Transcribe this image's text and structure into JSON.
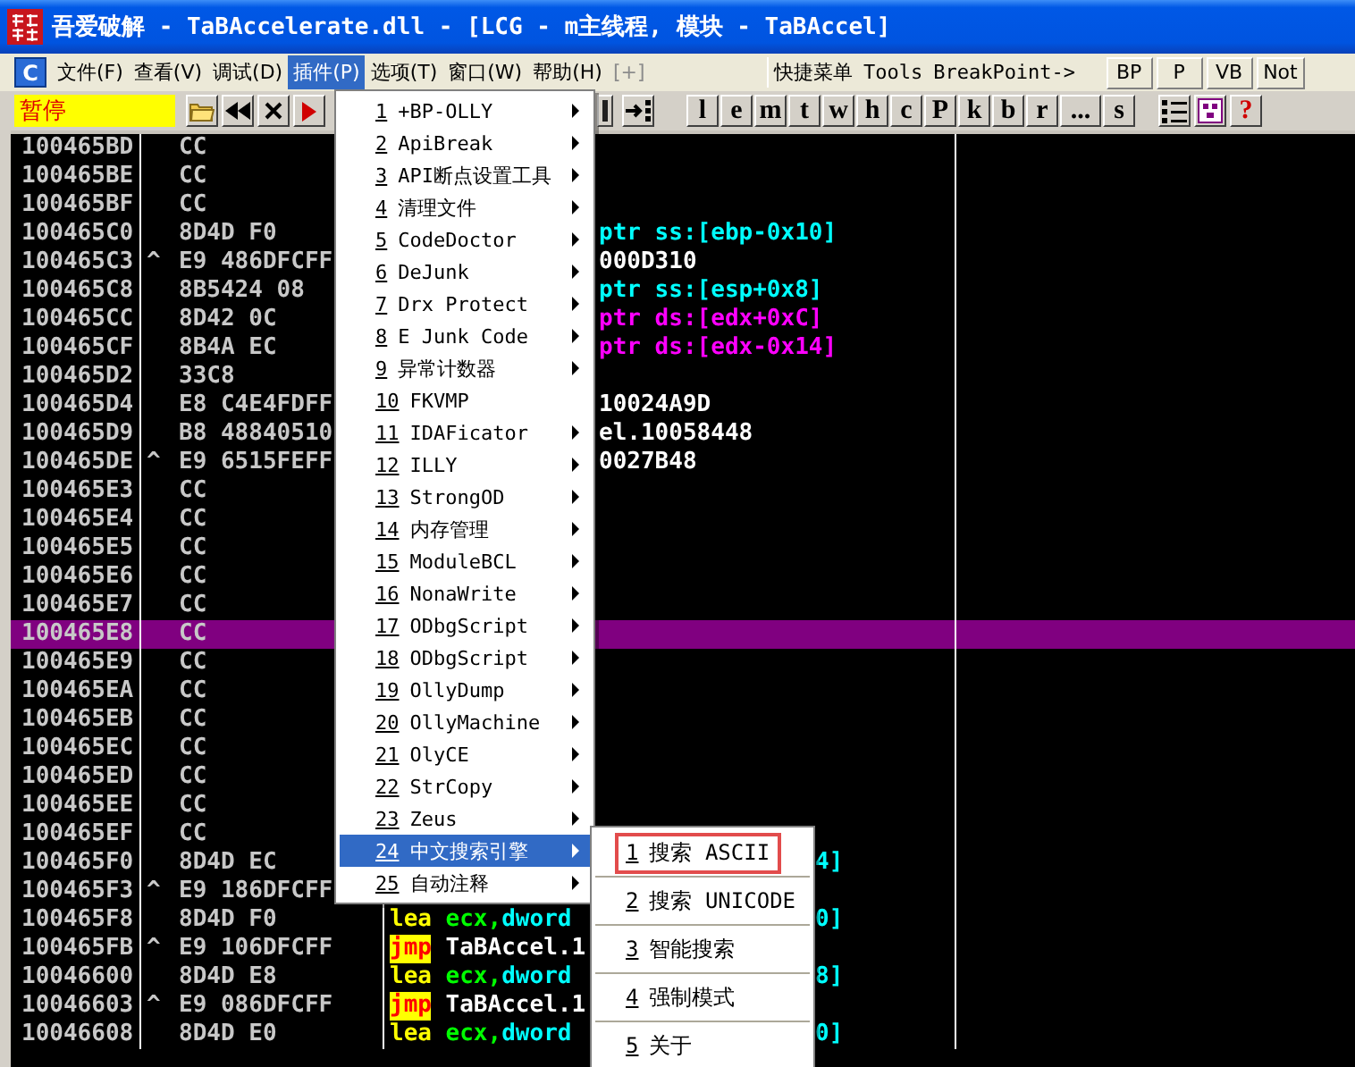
{
  "window": {
    "title": "吾爱破解 - TaBAccelerate.dll - [LCG - m主线程, 模块 - TaBAccel]"
  },
  "menubar": {
    "app_button": "C",
    "menus": [
      {
        "label": "文件(F)",
        "selected": false,
        "disabled": false
      },
      {
        "label": "查看(V)",
        "selected": false,
        "disabled": false
      },
      {
        "label": "调试(D)",
        "selected": false,
        "disabled": false
      },
      {
        "label": "插件(P)",
        "selected": true,
        "disabled": false
      },
      {
        "label": "选项(T)",
        "selected": false,
        "disabled": false
      },
      {
        "label": "窗口(W)",
        "selected": false,
        "disabled": false
      },
      {
        "label": "帮助(H)",
        "selected": false,
        "disabled": false
      },
      {
        "label": "[+]",
        "selected": false,
        "disabled": true
      },
      {
        "label": "快捷菜单",
        "selected": false,
        "disabled": false
      },
      {
        "label": "Tools",
        "selected": false,
        "disabled": false
      },
      {
        "label": "BreakPoint->",
        "selected": false,
        "disabled": false
      }
    ],
    "buttons": [
      "BP",
      "P",
      "VB",
      "Not"
    ]
  },
  "toolbar": {
    "status": "暂停",
    "letter_buttons": [
      "l",
      "e",
      "m",
      "t",
      "w",
      "h",
      "c",
      "P",
      "k",
      "b",
      "r",
      "...",
      "s"
    ],
    "help_button": "?"
  },
  "disassembly": {
    "rows": [
      {
        "address": "100465BD",
        "hex": "CC",
        "selected": false,
        "kind": "under-menu"
      },
      {
        "address": "100465BE",
        "hex": "CC",
        "selected": false,
        "kind": "under-menu"
      },
      {
        "address": "100465BF",
        "hex": "CC",
        "selected": false,
        "kind": "under-menu"
      },
      {
        "address": "100465C0",
        "hex": "8D4D F0",
        "selected": false,
        "kind": "under-menu",
        "right": [
          {
            "text": "ptr ss:[ebp-0x10]",
            "kind": "stack-ref"
          }
        ]
      },
      {
        "address": "100465C3",
        "jump_mark": "^",
        "hex": "E9 486DFCFF",
        "selected": false,
        "kind": "under-menu",
        "right": [
          {
            "text": "000D310",
            "kind": "value"
          }
        ]
      },
      {
        "address": "100465C8",
        "hex": "8B5424 08",
        "selected": false,
        "kind": "under-menu",
        "right": [
          {
            "text": "ptr ss:[esp+0x8]",
            "kind": "stack-ref"
          }
        ]
      },
      {
        "address": "100465CC",
        "hex": "8D42 0C",
        "selected": false,
        "kind": "under-menu",
        "right": [
          {
            "text": "ptr ds:[edx+0xC]",
            "kind": "data-ref"
          }
        ]
      },
      {
        "address": "100465CF",
        "hex": "8B4A EC",
        "selected": false,
        "kind": "under-menu",
        "right": [
          {
            "text": "ptr ds:[edx-0x14]",
            "kind": "data-ref"
          }
        ]
      },
      {
        "address": "100465D2",
        "hex": "33C8",
        "selected": false,
        "kind": "under-menu"
      },
      {
        "address": "100465D4",
        "hex": "E8 C4E4FDFF",
        "selected": false,
        "kind": "under-menu",
        "right": [
          {
            "text": "10024A9D",
            "kind": "value"
          }
        ]
      },
      {
        "address": "100465D9",
        "hex": "B8 48840510",
        "selected": false,
        "kind": "under-menu",
        "right": [
          {
            "text": "el.10058448",
            "kind": "value"
          }
        ]
      },
      {
        "address": "100465DE",
        "jump_mark": "^",
        "hex": "E9 6515FEFF",
        "selected": false,
        "kind": "under-menu",
        "right": [
          {
            "text": "0027B48",
            "kind": "value"
          }
        ]
      },
      {
        "address": "100465E3",
        "hex": "CC",
        "selected": false,
        "kind": "under-menu"
      },
      {
        "address": "100465E4",
        "hex": "CC",
        "selected": false,
        "kind": "under-menu"
      },
      {
        "address": "100465E5",
        "hex": "CC",
        "selected": false,
        "kind": "under-menu"
      },
      {
        "address": "100465E6",
        "hex": "CC",
        "selected": false,
        "kind": "under-menu"
      },
      {
        "address": "100465E7",
        "hex": "CC",
        "selected": false,
        "kind": "under-menu"
      },
      {
        "address": "100465E8",
        "hex": "CC",
        "selected": true,
        "kind": "under-menu"
      },
      {
        "address": "100465E9",
        "hex": "CC",
        "selected": false,
        "kind": "under-menu"
      },
      {
        "address": "100465EA",
        "hex": "CC",
        "selected": false,
        "kind": "under-menu"
      },
      {
        "address": "100465EB",
        "hex": "CC",
        "selected": false,
        "kind": "under-menu"
      },
      {
        "address": "100465EC",
        "hex": "CC",
        "selected": false,
        "kind": "under-menu"
      },
      {
        "address": "100465ED",
        "hex": "CC",
        "selected": false,
        "kind": "under-menu"
      },
      {
        "address": "100465EE",
        "hex": "CC",
        "selected": false,
        "kind": "under-menu"
      },
      {
        "address": "100465EF",
        "hex": "CC",
        "selected": false,
        "kind": "under-menu"
      },
      {
        "address": "100465F0",
        "hex": "8D4D EC",
        "selected": false,
        "kind": "beside-submenu",
        "right": [
          {
            "text": "4]",
            "kind": "stack-ref"
          }
        ]
      },
      {
        "address": "100465F3",
        "jump_mark": "^",
        "hex": "E9 186DFCFF",
        "selected": false,
        "kind": "beside-submenu"
      },
      {
        "address": "100465F8",
        "hex": "8D4D F0",
        "selected": false,
        "kind": "beside-submenu",
        "left": [
          {
            "text": "lea",
            "kind": "mnemonic"
          },
          {
            "text": "ecx,",
            "kind": "register"
          },
          {
            "text": "dword",
            "kind": "stack-ref"
          }
        ],
        "right": [
          {
            "text": "0]",
            "kind": "stack-ref"
          }
        ]
      },
      {
        "address": "100465FB",
        "jump_mark": "^",
        "hex": "E9 106DFCFF",
        "selected": false,
        "kind": "beside-submenu",
        "left": [
          {
            "text": "jmp",
            "kind": "jump-mnemonic"
          },
          {
            "text": "TaBAccel.1",
            "kind": "value"
          }
        ]
      },
      {
        "address": "10046600",
        "hex": "8D4D E8",
        "selected": false,
        "kind": "beside-submenu",
        "left": [
          {
            "text": "lea",
            "kind": "mnemonic"
          },
          {
            "text": "ecx,",
            "kind": "register"
          },
          {
            "text": "dword",
            "kind": "stack-ref"
          }
        ],
        "right": [
          {
            "text": "8]",
            "kind": "stack-ref"
          }
        ]
      },
      {
        "address": "10046603",
        "jump_mark": "^",
        "hex": "E9 086DFCFF",
        "selected": false,
        "kind": "beside-submenu",
        "left": [
          {
            "text": "jmp",
            "kind": "jump-mnemonic"
          },
          {
            "text": "TaBAccel.1",
            "kind": "value"
          }
        ]
      },
      {
        "address": "10046608",
        "hex": "8D4D E0",
        "selected": false,
        "kind": "beside-submenu",
        "left": [
          {
            "text": "lea",
            "kind": "mnemonic"
          },
          {
            "text": "ecx,",
            "kind": "register"
          },
          {
            "text": "dword",
            "kind": "stack-ref"
          }
        ],
        "right": [
          {
            "text": "0]",
            "kind": "stack-ref"
          }
        ]
      }
    ]
  },
  "plugin_menu": {
    "items": [
      {
        "number": "1",
        "label": "+BP-OLLY",
        "submenu": true,
        "selected": false
      },
      {
        "number": "2",
        "label": "ApiBreak",
        "submenu": true,
        "selected": false
      },
      {
        "number": "3",
        "label": "API断点设置工具",
        "submenu": true,
        "selected": false
      },
      {
        "number": "4",
        "label": "清理文件",
        "submenu": true,
        "selected": false
      },
      {
        "number": "5",
        "label": "CodeDoctor",
        "submenu": true,
        "selected": false
      },
      {
        "number": "6",
        "label": "DeJunk",
        "submenu": true,
        "selected": false
      },
      {
        "number": "7",
        "label": "Drx Protect",
        "submenu": true,
        "selected": false
      },
      {
        "number": "8",
        "label": "E Junk Code",
        "submenu": true,
        "selected": false
      },
      {
        "number": "9",
        "label": "异常计数器",
        "submenu": true,
        "selected": false
      },
      {
        "number": "10",
        "label": "FKVMP",
        "submenu": false,
        "selected": false
      },
      {
        "number": "11",
        "label": "IDAFicator",
        "submenu": true,
        "selected": false
      },
      {
        "number": "12",
        "label": "ILLY",
        "submenu": true,
        "selected": false
      },
      {
        "number": "13",
        "label": "StrongOD",
        "submenu": true,
        "selected": false
      },
      {
        "number": "14",
        "label": "内存管理",
        "submenu": true,
        "selected": false
      },
      {
        "number": "15",
        "label": "ModuleBCL",
        "submenu": true,
        "selected": false
      },
      {
        "number": "16",
        "label": "NonaWrite",
        "submenu": true,
        "selected": false
      },
      {
        "number": "17",
        "label": "ODbgScript",
        "submenu": true,
        "selected": false
      },
      {
        "number": "18",
        "label": "ODbgScript",
        "submenu": true,
        "selected": false
      },
      {
        "number": "19",
        "label": "OllyDump",
        "submenu": true,
        "selected": false
      },
      {
        "number": "20",
        "label": "OllyMachine",
        "submenu": true,
        "selected": false
      },
      {
        "number": "21",
        "label": "OlyCE",
        "submenu": true,
        "selected": false
      },
      {
        "number": "22",
        "label": "StrCopy",
        "submenu": true,
        "selected": false
      },
      {
        "number": "23",
        "label": "Zeus",
        "submenu": true,
        "selected": false
      },
      {
        "number": "24",
        "label": "中文搜索引擎",
        "submenu": true,
        "selected": true
      },
      {
        "number": "25",
        "label": "自动注释",
        "submenu": true,
        "selected": false
      }
    ]
  },
  "search_submenu": {
    "items": [
      {
        "number": "1",
        "label": "搜索 ASCII",
        "highlighted": true
      },
      {
        "number": "2",
        "label": "搜索 UNICODE",
        "highlighted": false
      },
      {
        "number": "3",
        "label": "智能搜索",
        "highlighted": false
      },
      {
        "number": "4",
        "label": "强制模式",
        "highlighted": false
      },
      {
        "number": "5",
        "label": "关于",
        "highlighted": false
      }
    ]
  }
}
